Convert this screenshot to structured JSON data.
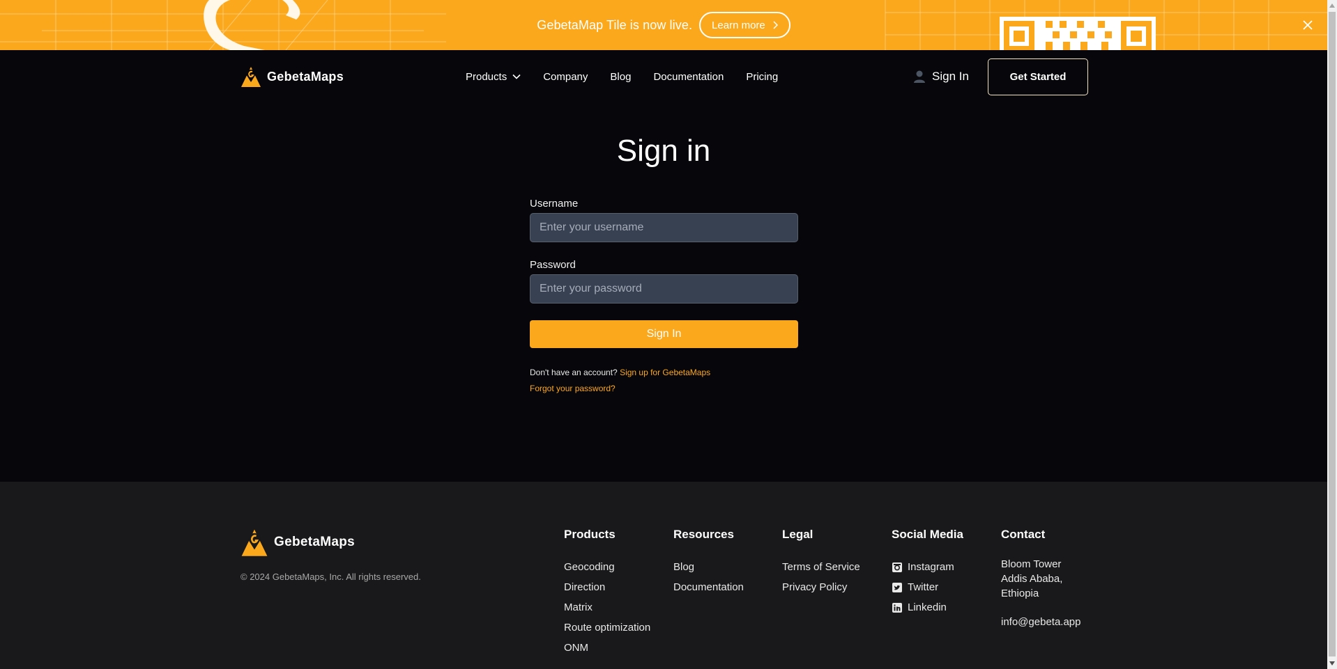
{
  "banner": {
    "text": "GebetaMap Tile is now live.",
    "learn_more": "Learn more"
  },
  "header": {
    "brand": "GebetaMaps",
    "nav": {
      "products": "Products",
      "company": "Company",
      "blog": "Blog",
      "documentation": "Documentation",
      "pricing": "Pricing"
    },
    "sign_in": "Sign In",
    "get_started": "Get Started"
  },
  "signin": {
    "title": "Sign in",
    "username_label": "Username",
    "username_placeholder": "Enter your username",
    "username_value": "",
    "password_label": "Password",
    "password_placeholder": "Enter your password",
    "password_value": "",
    "submit": "Sign In",
    "no_account": "Don't have an account?",
    "signup_link": "Sign up for GebetaMaps",
    "forgot_link": "Forgot your password?"
  },
  "footer": {
    "brand": "GebetaMaps",
    "copyright": "© 2024 GebetaMaps, Inc. All rights reserved.",
    "products": {
      "title": "Products",
      "items": [
        "Geocoding",
        "Direction",
        "Matrix",
        "Route optimization",
        "ONM"
      ]
    },
    "resources": {
      "title": "Resources",
      "items": [
        "Blog",
        "Documentation"
      ]
    },
    "legal": {
      "title": "Legal",
      "items": [
        "Terms of Service",
        "Privacy Policy"
      ]
    },
    "social": {
      "title": "Social Media",
      "items": [
        {
          "label": "Instagram",
          "icon": "instagram-icon"
        },
        {
          "label": "Twitter",
          "icon": "twitter-icon"
        },
        {
          "label": "Linkedin",
          "icon": "linkedin-icon"
        }
      ]
    },
    "contact": {
      "title": "Contact",
      "address_line1": "Bloom Tower",
      "address_line2": "Addis Ababa,",
      "address_line3": "Ethiopia",
      "email": "info@gebeta.app"
    }
  },
  "colors": {
    "accent": "#fca81c",
    "background": "#07070b",
    "footer_bg": "#19191b",
    "input_bg": "#374152"
  }
}
